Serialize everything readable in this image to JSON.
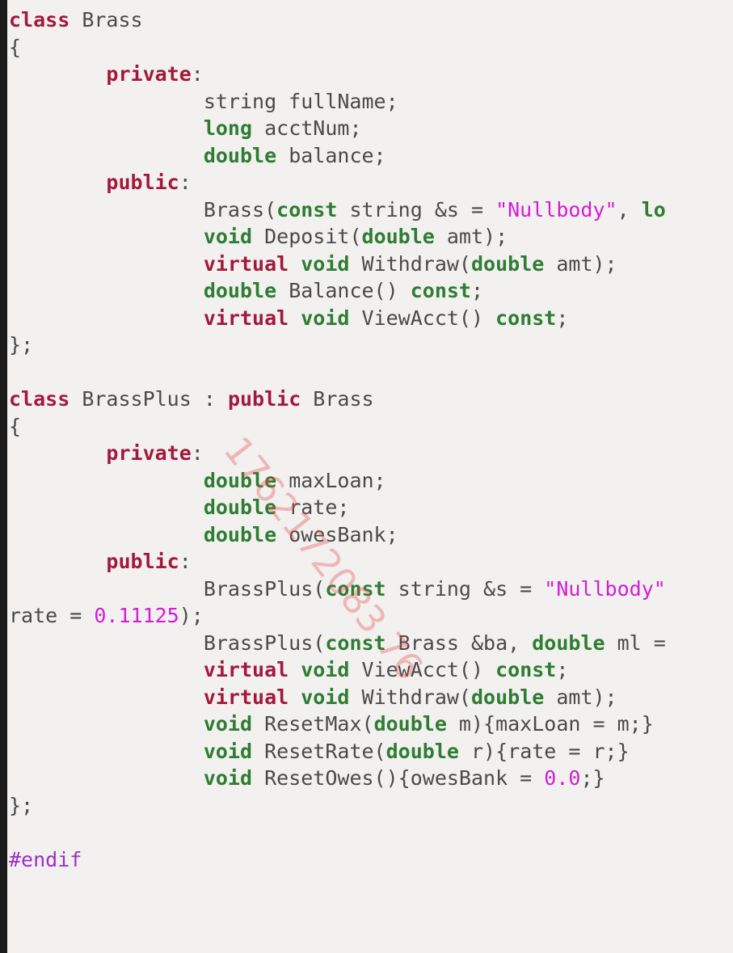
{
  "editor": {
    "colors": {
      "background": "#f2f1f0",
      "keyword": "#a3193b",
      "type": "#2e7d32",
      "string": "#d11fd1",
      "number": "#d11fd1",
      "preprocessor": "#9b2fc9",
      "plain": "#4a4a4a"
    },
    "lines": [
      [
        {
          "t": "kw",
          "v": "class"
        },
        {
          "t": "pl",
          "v": " Brass"
        }
      ],
      [
        {
          "t": "pl",
          "v": "{"
        }
      ],
      [
        {
          "t": "pl",
          "v": "        "
        },
        {
          "t": "kw",
          "v": "private"
        },
        {
          "t": "pl",
          "v": ":"
        }
      ],
      [
        {
          "t": "pl",
          "v": "                string fullName;"
        }
      ],
      [
        {
          "t": "pl",
          "v": "                "
        },
        {
          "t": "ty",
          "v": "long"
        },
        {
          "t": "pl",
          "v": " acctNum;"
        }
      ],
      [
        {
          "t": "pl",
          "v": "                "
        },
        {
          "t": "ty",
          "v": "double"
        },
        {
          "t": "pl",
          "v": " balance;"
        }
      ],
      [
        {
          "t": "pl",
          "v": "        "
        },
        {
          "t": "kw",
          "v": "public"
        },
        {
          "t": "pl",
          "v": ":"
        }
      ],
      [
        {
          "t": "pl",
          "v": "                Brass("
        },
        {
          "t": "ty",
          "v": "const"
        },
        {
          "t": "pl",
          "v": " string &s = "
        },
        {
          "t": "str",
          "v": "\"Nullbody\""
        },
        {
          "t": "pl",
          "v": ", "
        },
        {
          "t": "ty",
          "v": "lo"
        }
      ],
      [
        {
          "t": "pl",
          "v": "                "
        },
        {
          "t": "ty",
          "v": "void"
        },
        {
          "t": "pl",
          "v": " Deposit("
        },
        {
          "t": "ty",
          "v": "double"
        },
        {
          "t": "pl",
          "v": " amt);"
        }
      ],
      [
        {
          "t": "pl",
          "v": "                "
        },
        {
          "t": "kw",
          "v": "virtual"
        },
        {
          "t": "pl",
          "v": " "
        },
        {
          "t": "ty",
          "v": "void"
        },
        {
          "t": "pl",
          "v": " Withdraw("
        },
        {
          "t": "ty",
          "v": "double"
        },
        {
          "t": "pl",
          "v": " amt);"
        }
      ],
      [
        {
          "t": "pl",
          "v": "                "
        },
        {
          "t": "ty",
          "v": "double"
        },
        {
          "t": "pl",
          "v": " Balance() "
        },
        {
          "t": "ty",
          "v": "const"
        },
        {
          "t": "pl",
          "v": ";"
        }
      ],
      [
        {
          "t": "pl",
          "v": "                "
        },
        {
          "t": "kw",
          "v": "virtual"
        },
        {
          "t": "pl",
          "v": " "
        },
        {
          "t": "ty",
          "v": "void"
        },
        {
          "t": "pl",
          "v": " ViewAcct() "
        },
        {
          "t": "ty",
          "v": "const"
        },
        {
          "t": "pl",
          "v": ";"
        }
      ],
      [
        {
          "t": "pl",
          "v": "};"
        }
      ],
      [
        {
          "t": "pl",
          "v": ""
        }
      ],
      [
        {
          "t": "kw",
          "v": "class"
        },
        {
          "t": "pl",
          "v": " BrassPlus : "
        },
        {
          "t": "kw",
          "v": "public"
        },
        {
          "t": "pl",
          "v": " Brass"
        }
      ],
      [
        {
          "t": "pl",
          "v": "{"
        }
      ],
      [
        {
          "t": "pl",
          "v": "        "
        },
        {
          "t": "kw",
          "v": "private"
        },
        {
          "t": "pl",
          "v": ":"
        }
      ],
      [
        {
          "t": "pl",
          "v": "                "
        },
        {
          "t": "ty",
          "v": "double"
        },
        {
          "t": "pl",
          "v": " maxLoan;"
        }
      ],
      [
        {
          "t": "pl",
          "v": "                "
        },
        {
          "t": "ty",
          "v": "double"
        },
        {
          "t": "pl",
          "v": " rate;"
        }
      ],
      [
        {
          "t": "pl",
          "v": "                "
        },
        {
          "t": "ty",
          "v": "double"
        },
        {
          "t": "pl",
          "v": " owesBank;"
        }
      ],
      [
        {
          "t": "pl",
          "v": "        "
        },
        {
          "t": "kw",
          "v": "public"
        },
        {
          "t": "pl",
          "v": ":"
        }
      ],
      [
        {
          "t": "pl",
          "v": "                BrassPlus("
        },
        {
          "t": "ty",
          "v": "const"
        },
        {
          "t": "pl",
          "v": " string &s = "
        },
        {
          "t": "str",
          "v": "\"Nullbody\""
        }
      ],
      [
        {
          "t": "pl",
          "v": "rate = "
        },
        {
          "t": "num",
          "v": "0.11125"
        },
        {
          "t": "pl",
          "v": ");"
        }
      ],
      [
        {
          "t": "pl",
          "v": "                BrassPlus("
        },
        {
          "t": "ty",
          "v": "const"
        },
        {
          "t": "pl",
          "v": " Brass &ba, "
        },
        {
          "t": "ty",
          "v": "double"
        },
        {
          "t": "pl",
          "v": " ml ="
        }
      ],
      [
        {
          "t": "pl",
          "v": "                "
        },
        {
          "t": "kw",
          "v": "virtual"
        },
        {
          "t": "pl",
          "v": " "
        },
        {
          "t": "ty",
          "v": "void"
        },
        {
          "t": "pl",
          "v": " ViewAcct() "
        },
        {
          "t": "ty",
          "v": "const"
        },
        {
          "t": "pl",
          "v": ";"
        }
      ],
      [
        {
          "t": "pl",
          "v": "                "
        },
        {
          "t": "kw",
          "v": "virtual"
        },
        {
          "t": "pl",
          "v": " "
        },
        {
          "t": "ty",
          "v": "void"
        },
        {
          "t": "pl",
          "v": " Withdraw("
        },
        {
          "t": "ty",
          "v": "double"
        },
        {
          "t": "pl",
          "v": " amt);"
        }
      ],
      [
        {
          "t": "pl",
          "v": "                "
        },
        {
          "t": "ty",
          "v": "void"
        },
        {
          "t": "pl",
          "v": " ResetMax("
        },
        {
          "t": "ty",
          "v": "double"
        },
        {
          "t": "pl",
          "v": " m){maxLoan = m;}"
        }
      ],
      [
        {
          "t": "pl",
          "v": "                "
        },
        {
          "t": "ty",
          "v": "void"
        },
        {
          "t": "pl",
          "v": " ResetRate("
        },
        {
          "t": "ty",
          "v": "double"
        },
        {
          "t": "pl",
          "v": " r){rate = r;}"
        }
      ],
      [
        {
          "t": "pl",
          "v": "                "
        },
        {
          "t": "ty",
          "v": "void"
        },
        {
          "t": "pl",
          "v": " ResetOwes(){owesBank = "
        },
        {
          "t": "num",
          "v": "0.0"
        },
        {
          "t": "pl",
          "v": ";}"
        }
      ],
      [
        {
          "t": "pl",
          "v": "};"
        }
      ],
      [
        {
          "t": "pl",
          "v": ""
        }
      ],
      [
        {
          "t": "pp",
          "v": "#endif"
        }
      ]
    ]
  },
  "watermark": {
    "text": "1762172083 76"
  }
}
